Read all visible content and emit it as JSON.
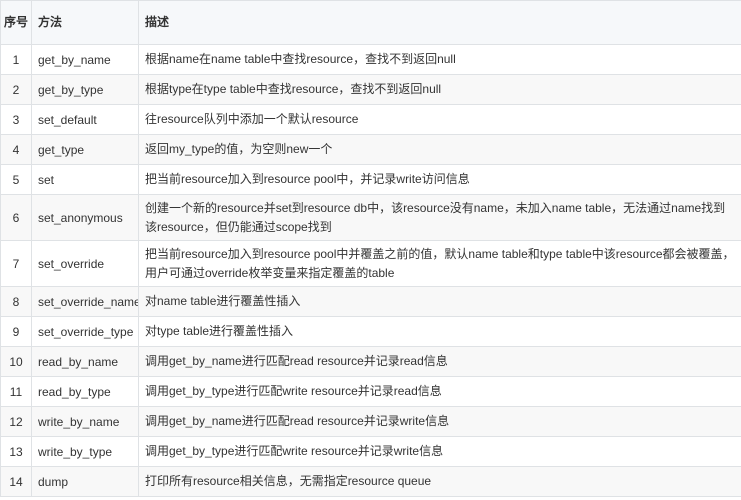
{
  "table": {
    "headers": {
      "index": "序号",
      "method": "方法",
      "description": "描述"
    },
    "rows": [
      {
        "index": "1",
        "method": "get_by_name",
        "description": "根据name在name table中查找resource，查找不到返回null"
      },
      {
        "index": "2",
        "method": "get_by_type",
        "description": "根据type在type table中查找resource，查找不到返回null"
      },
      {
        "index": "3",
        "method": "set_default",
        "description": "往resource队列中添加一个默认resource"
      },
      {
        "index": "4",
        "method": "get_type",
        "description": "返回my_type的值，为空则new一个"
      },
      {
        "index": "5",
        "method": "set",
        "description": "把当前resource加入到resource pool中，并记录write访问信息"
      },
      {
        "index": "6",
        "method": "set_anonymous",
        "description": "创建一个新的resource并set到resource db中，该resource没有name，未加入name table，无法通过name找到该resource，但仍能通过scope找到"
      },
      {
        "index": "7",
        "method": "set_override",
        "description": "把当前resource加入到resource pool中并覆盖之前的值，默认name table和type table中该resource都会被覆盖，用户可通过override枚举变量来指定覆盖的table"
      },
      {
        "index": "8",
        "method": "set_override_name",
        "description": "对name table进行覆盖性插入"
      },
      {
        "index": "9",
        "method": "set_override_type",
        "description": "对type table进行覆盖性插入"
      },
      {
        "index": "10",
        "method": "read_by_name",
        "description": "调用get_by_name进行匹配read resource并记录read信息"
      },
      {
        "index": "11",
        "method": "read_by_type",
        "description": "调用get_by_type进行匹配write resource并记录read信息"
      },
      {
        "index": "12",
        "method": "write_by_name",
        "description": "调用get_by_name进行匹配read resource并记录write信息"
      },
      {
        "index": "13",
        "method": "write_by_type",
        "description": "调用get_by_type进行匹配write resource并记录write信息"
      },
      {
        "index": "14",
        "method": "dump",
        "description": "打印所有resource相关信息，无需指定resource queue"
      }
    ]
  }
}
